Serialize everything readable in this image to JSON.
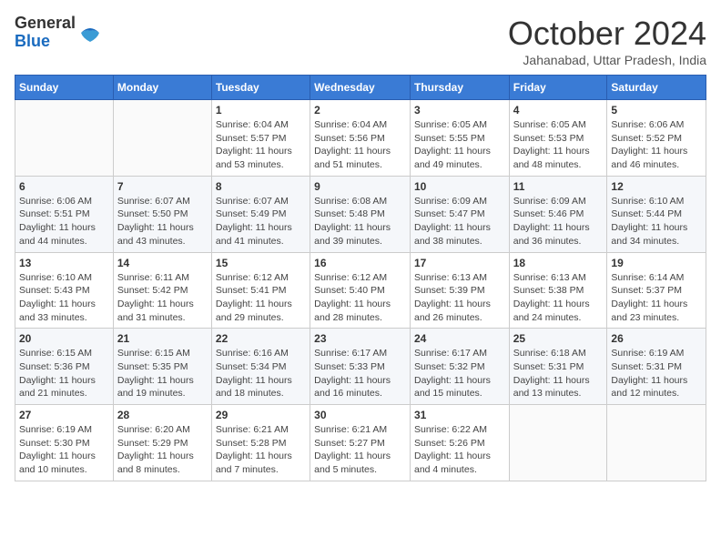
{
  "header": {
    "logo_general": "General",
    "logo_blue": "Blue",
    "month_title": "October 2024",
    "subtitle": "Jahanabad, Uttar Pradesh, India"
  },
  "weekdays": [
    "Sunday",
    "Monday",
    "Tuesday",
    "Wednesday",
    "Thursday",
    "Friday",
    "Saturday"
  ],
  "weeks": [
    [
      {
        "day": "",
        "sunrise": "",
        "sunset": "",
        "daylight": ""
      },
      {
        "day": "",
        "sunrise": "",
        "sunset": "",
        "daylight": ""
      },
      {
        "day": "1",
        "sunrise": "Sunrise: 6:04 AM",
        "sunset": "Sunset: 5:57 PM",
        "daylight": "Daylight: 11 hours and 53 minutes."
      },
      {
        "day": "2",
        "sunrise": "Sunrise: 6:04 AM",
        "sunset": "Sunset: 5:56 PM",
        "daylight": "Daylight: 11 hours and 51 minutes."
      },
      {
        "day": "3",
        "sunrise": "Sunrise: 6:05 AM",
        "sunset": "Sunset: 5:55 PM",
        "daylight": "Daylight: 11 hours and 49 minutes."
      },
      {
        "day": "4",
        "sunrise": "Sunrise: 6:05 AM",
        "sunset": "Sunset: 5:53 PM",
        "daylight": "Daylight: 11 hours and 48 minutes."
      },
      {
        "day": "5",
        "sunrise": "Sunrise: 6:06 AM",
        "sunset": "Sunset: 5:52 PM",
        "daylight": "Daylight: 11 hours and 46 minutes."
      }
    ],
    [
      {
        "day": "6",
        "sunrise": "Sunrise: 6:06 AM",
        "sunset": "Sunset: 5:51 PM",
        "daylight": "Daylight: 11 hours and 44 minutes."
      },
      {
        "day": "7",
        "sunrise": "Sunrise: 6:07 AM",
        "sunset": "Sunset: 5:50 PM",
        "daylight": "Daylight: 11 hours and 43 minutes."
      },
      {
        "day": "8",
        "sunrise": "Sunrise: 6:07 AM",
        "sunset": "Sunset: 5:49 PM",
        "daylight": "Daylight: 11 hours and 41 minutes."
      },
      {
        "day": "9",
        "sunrise": "Sunrise: 6:08 AM",
        "sunset": "Sunset: 5:48 PM",
        "daylight": "Daylight: 11 hours and 39 minutes."
      },
      {
        "day": "10",
        "sunrise": "Sunrise: 6:09 AM",
        "sunset": "Sunset: 5:47 PM",
        "daylight": "Daylight: 11 hours and 38 minutes."
      },
      {
        "day": "11",
        "sunrise": "Sunrise: 6:09 AM",
        "sunset": "Sunset: 5:46 PM",
        "daylight": "Daylight: 11 hours and 36 minutes."
      },
      {
        "day": "12",
        "sunrise": "Sunrise: 6:10 AM",
        "sunset": "Sunset: 5:44 PM",
        "daylight": "Daylight: 11 hours and 34 minutes."
      }
    ],
    [
      {
        "day": "13",
        "sunrise": "Sunrise: 6:10 AM",
        "sunset": "Sunset: 5:43 PM",
        "daylight": "Daylight: 11 hours and 33 minutes."
      },
      {
        "day": "14",
        "sunrise": "Sunrise: 6:11 AM",
        "sunset": "Sunset: 5:42 PM",
        "daylight": "Daylight: 11 hours and 31 minutes."
      },
      {
        "day": "15",
        "sunrise": "Sunrise: 6:12 AM",
        "sunset": "Sunset: 5:41 PM",
        "daylight": "Daylight: 11 hours and 29 minutes."
      },
      {
        "day": "16",
        "sunrise": "Sunrise: 6:12 AM",
        "sunset": "Sunset: 5:40 PM",
        "daylight": "Daylight: 11 hours and 28 minutes."
      },
      {
        "day": "17",
        "sunrise": "Sunrise: 6:13 AM",
        "sunset": "Sunset: 5:39 PM",
        "daylight": "Daylight: 11 hours and 26 minutes."
      },
      {
        "day": "18",
        "sunrise": "Sunrise: 6:13 AM",
        "sunset": "Sunset: 5:38 PM",
        "daylight": "Daylight: 11 hours and 24 minutes."
      },
      {
        "day": "19",
        "sunrise": "Sunrise: 6:14 AM",
        "sunset": "Sunset: 5:37 PM",
        "daylight": "Daylight: 11 hours and 23 minutes."
      }
    ],
    [
      {
        "day": "20",
        "sunrise": "Sunrise: 6:15 AM",
        "sunset": "Sunset: 5:36 PM",
        "daylight": "Daylight: 11 hours and 21 minutes."
      },
      {
        "day": "21",
        "sunrise": "Sunrise: 6:15 AM",
        "sunset": "Sunset: 5:35 PM",
        "daylight": "Daylight: 11 hours and 19 minutes."
      },
      {
        "day": "22",
        "sunrise": "Sunrise: 6:16 AM",
        "sunset": "Sunset: 5:34 PM",
        "daylight": "Daylight: 11 hours and 18 minutes."
      },
      {
        "day": "23",
        "sunrise": "Sunrise: 6:17 AM",
        "sunset": "Sunset: 5:33 PM",
        "daylight": "Daylight: 11 hours and 16 minutes."
      },
      {
        "day": "24",
        "sunrise": "Sunrise: 6:17 AM",
        "sunset": "Sunset: 5:32 PM",
        "daylight": "Daylight: 11 hours and 15 minutes."
      },
      {
        "day": "25",
        "sunrise": "Sunrise: 6:18 AM",
        "sunset": "Sunset: 5:31 PM",
        "daylight": "Daylight: 11 hours and 13 minutes."
      },
      {
        "day": "26",
        "sunrise": "Sunrise: 6:19 AM",
        "sunset": "Sunset: 5:31 PM",
        "daylight": "Daylight: 11 hours and 12 minutes."
      }
    ],
    [
      {
        "day": "27",
        "sunrise": "Sunrise: 6:19 AM",
        "sunset": "Sunset: 5:30 PM",
        "daylight": "Daylight: 11 hours and 10 minutes."
      },
      {
        "day": "28",
        "sunrise": "Sunrise: 6:20 AM",
        "sunset": "Sunset: 5:29 PM",
        "daylight": "Daylight: 11 hours and 8 minutes."
      },
      {
        "day": "29",
        "sunrise": "Sunrise: 6:21 AM",
        "sunset": "Sunset: 5:28 PM",
        "daylight": "Daylight: 11 hours and 7 minutes."
      },
      {
        "day": "30",
        "sunrise": "Sunrise: 6:21 AM",
        "sunset": "Sunset: 5:27 PM",
        "daylight": "Daylight: 11 hours and 5 minutes."
      },
      {
        "day": "31",
        "sunrise": "Sunrise: 6:22 AM",
        "sunset": "Sunset: 5:26 PM",
        "daylight": "Daylight: 11 hours and 4 minutes."
      },
      {
        "day": "",
        "sunrise": "",
        "sunset": "",
        "daylight": ""
      },
      {
        "day": "",
        "sunrise": "",
        "sunset": "",
        "daylight": ""
      }
    ]
  ]
}
